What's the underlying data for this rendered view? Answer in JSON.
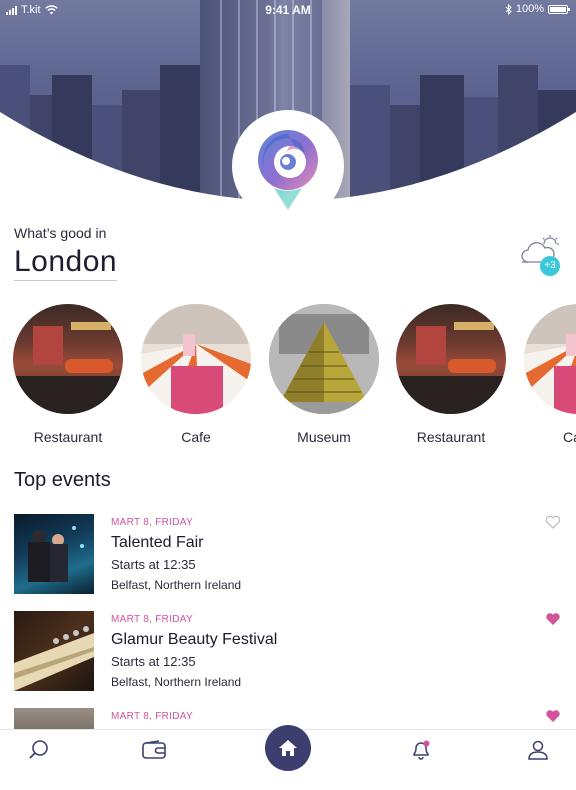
{
  "status_bar": {
    "carrier": "T.kit",
    "time": "9:41 AM",
    "battery": "100%"
  },
  "header": {
    "prompt": "What’s good in",
    "city": "London",
    "weather_badge": "+3"
  },
  "categories": [
    {
      "label": "Restaurant"
    },
    {
      "label": "Cafe"
    },
    {
      "label": "Museum"
    },
    {
      "label": "Restaurant"
    },
    {
      "label": "Ca"
    }
  ],
  "section_title": "Top events",
  "events": [
    {
      "date": "MART 8, FRIDAY",
      "name": "Talented Fair",
      "time": "Starts at 12:35",
      "place": "Belfast, Northern Ireland",
      "liked": false
    },
    {
      "date": "MART 8, FRIDAY",
      "name": "Glamur Beauty Festival",
      "time": "Starts at 12:35",
      "place": "Belfast, Northern Ireland",
      "liked": true
    },
    {
      "date": "MART 8, FRIDAY",
      "liked": true
    }
  ],
  "colors": {
    "accent_pink": "#d1549d",
    "navy": "#3b3e6e",
    "teal": "#3cc6d9"
  },
  "tab_bar": {
    "items": [
      "search-icon",
      "wallet-icon",
      "home-icon",
      "notification-bell-icon",
      "profile-icon"
    ],
    "active": "home-icon"
  }
}
